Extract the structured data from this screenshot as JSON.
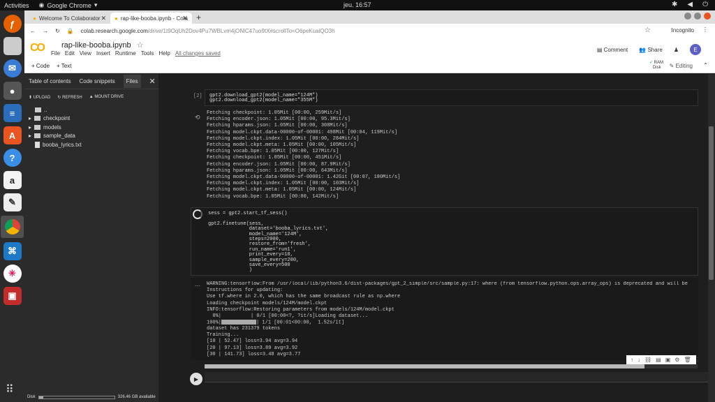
{
  "os": {
    "activities": "Activities",
    "app": "Google Chrome",
    "clock": "jeu. 16:57"
  },
  "browser": {
    "tabs": [
      {
        "label": "Welcome To Colaborator"
      },
      {
        "label": "rap-like-booba.ipynb - Cola"
      }
    ],
    "url": "colab.research.google.com",
    "url_path": "/drive/1t9OqUh2Dov4Pu7WBLvm4jONlC47uo9tX#scrollTo=O6peKualQO3h",
    "incognito": "Incognito"
  },
  "colab": {
    "logo": "CO",
    "filename": "rap-like-booba.ipynb",
    "menu": [
      "File",
      "Edit",
      "View",
      "Insert",
      "Runtime",
      "Tools",
      "Help"
    ],
    "saved": "All changes saved",
    "comment": "Comment",
    "share": "Share",
    "avatar": "E",
    "add_code": "+ Code",
    "add_text": "+ Text",
    "ram": "RAM",
    "disk_label": "Disk",
    "editing": "Editing"
  },
  "sidebar": {
    "tabs": [
      "Table of contents",
      "Code snippets",
      "Files"
    ],
    "actions": [
      "UPLOAD",
      "REFRESH",
      "MOUNT DRIVE"
    ],
    "tree": [
      {
        "label": "..",
        "type": "folder"
      },
      {
        "label": "checkpoint",
        "type": "folder"
      },
      {
        "label": "models",
        "type": "folder"
      },
      {
        "label": "sample_data",
        "type": "folder"
      },
      {
        "label": "booba_lyrics.txt",
        "type": "file"
      }
    ],
    "disk": "Disk",
    "disk_usage": "326.46 GB available",
    "disk_used_fraction": 0.06
  },
  "cells": {
    "cell1_num": "[2]",
    "cell1_code": "gpt2.download_gpt2(model_name=\"124M\")\ngpt2.download_gpt2(model_name=\"355M\")",
    "cell1_output": "Fetching checkpoint: 1.05Mit [00:00, 259Mit/s]\nFetching encoder.json: 1.05Mit [00:00, 95.3Mit/s]\nFetching hparams.json: 1.05Mit [00:00, 308Mit/s]\nFetching model.ckpt.data-00000-of-00001: 498Mit [00:04, 119Mit/s]\nFetching model.ckpt.index: 1.05Mit [00:00, 284Mit/s]\nFetching model.ckpt.meta: 1.05Mit [00:00, 105Mit/s]\nFetching vocab.bpe: 1.05Mit [00:00, 127Mit/s]\nFetching checkpoint: 1.05Mit [00:00, 451Mit/s]\nFetching encoder.json: 1.05Mit [00:00, 87.9Mit/s]\nFetching hparams.json: 1.05Mit [00:00, 643Mit/s]\nFetching model.ckpt.data-00000-of-00001: 1.42Git [00:07, 180Mit/s]\nFetching model.ckpt.index: 1.05Mit [00:00, 103Mit/s]\nFetching model.ckpt.meta: 1.05Mit [00:00, 124Mit/s]\nFetching vocab.bpe: 1.05Mit [00:00, 142Mit/s]",
    "cell2_code": "sess = gpt2.start_tf_sess()\n\ngpt2.finetune(sess,\n              dataset='booba_lyrics.txt',\n              model_name='124M',\n              steps=2000,\n              restore_from='fresh',\n              run_name='run1',\n              print_every=10,\n              sample_every=200,\n              save_every=500\n              )",
    "cell2_output_a": "WARNING:tensorflow:From /usr/local/lib/python3.6/dist-packages/gpt_2_simple/src/sample.py:17: where (from tensorflow.python.ops.array_ops) is deprecated and will be\nInstructions for updating:\nUse tf.where in 2.0, which has the same broadcast rule as np.where\nLoading checkpoint models/124M/model.ckpt\nINFO:tensorflow:Restoring parameters from models/124M/model.ckpt",
    "progress1": "  0%|          | 0/1 [00:00<?, ?it/s]Loading dataset...",
    "progress2": "100%|",
    "progress2_tail": "| 1/1 [00:01<00:00,  1.52s/it]",
    "cell2_output_b": "dataset has 231379 tokens\nTraining...\n[10 | 52.47] loss=3.94 avg=3.94\n[20 | 97.13] loss=3.89 avg=3.92\n[30 | 141.73] loss=3.48 avg=3.77",
    "ellipsis": "..."
  }
}
